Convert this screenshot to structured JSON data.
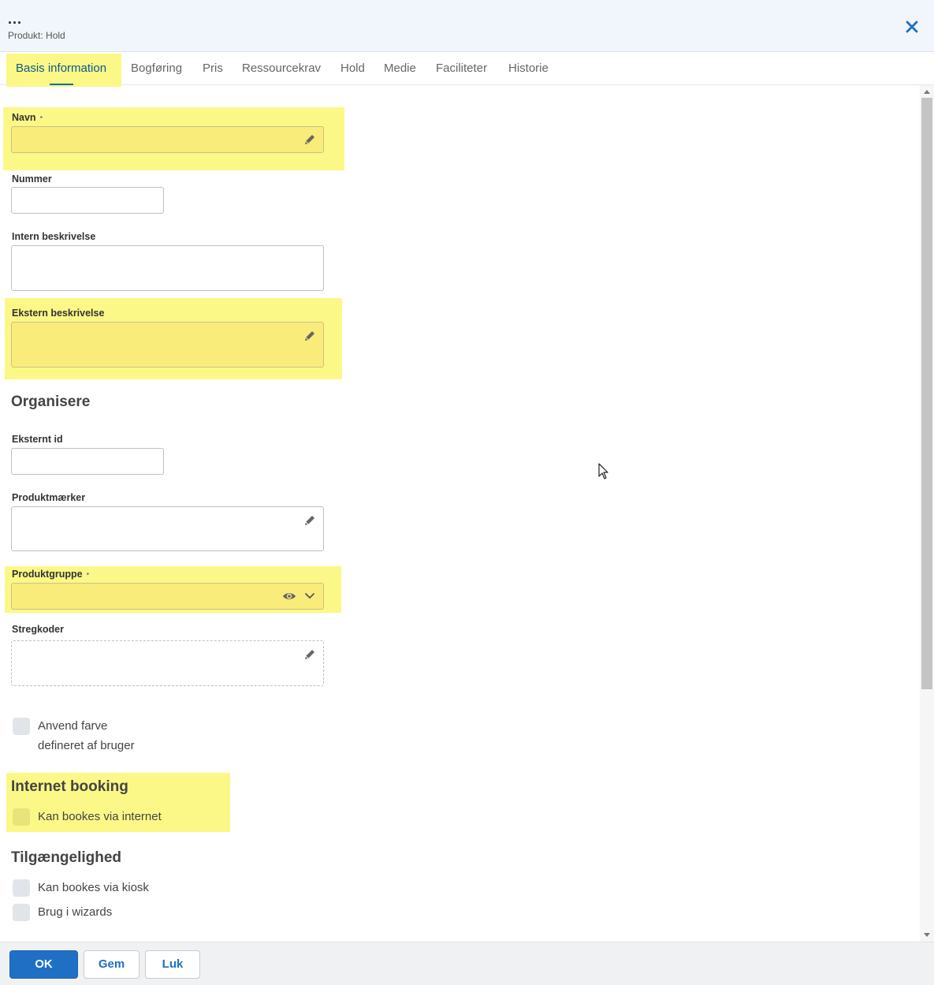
{
  "header": {
    "menu_label": "...",
    "subtitle": "Produkt: Hold"
  },
  "tabs": [
    {
      "label": "Basis information",
      "active": true
    },
    {
      "label": "Bogføring"
    },
    {
      "label": "Pris"
    },
    {
      "label": "Ressourcekrav"
    },
    {
      "label": "Hold"
    },
    {
      "label": "Medie"
    },
    {
      "label": "Faciliteter"
    },
    {
      "label": "Historie"
    }
  ],
  "form": {
    "navn": {
      "label": "Navn",
      "value": "",
      "required_marker": "•"
    },
    "nummer": {
      "label": "Nummer",
      "value": ""
    },
    "intern_beskrivelse": {
      "label": "Intern beskrivelse",
      "value": ""
    },
    "ekstern_beskrivelse": {
      "label": "Ekstern beskrivelse",
      "value": ""
    },
    "organisere_title": "Organisere",
    "eksternt_id": {
      "label": "Eksternt id",
      "value": ""
    },
    "produktmaerker": {
      "label": "Produktmærker",
      "value": ""
    },
    "produktgruppe": {
      "label": "Produktgruppe",
      "value": "",
      "required_marker": "•"
    },
    "stregkoder": {
      "label": "Stregkoder",
      "value": ""
    },
    "anvend_farve": {
      "line1": "Anvend farve",
      "line2": "defineret af bruger",
      "checked": false
    },
    "internet_title": "Internet booking",
    "kan_bookes_internet": {
      "label": "Kan bookes via internet",
      "checked": false
    },
    "tilgaengelighed_title": "Tilgængelighed",
    "kan_bookes_kiosk": {
      "label": "Kan bookes via kiosk",
      "checked": false
    },
    "brug_i_wizards": {
      "label": "Brug i wizards",
      "checked": false
    }
  },
  "footer": {
    "ok_label": "OK",
    "gem_label": "Gem",
    "luk_label": "Luk"
  },
  "colors": {
    "highlight": "#fbf887",
    "primary": "#1f6fc5",
    "active_tab": "#0a5a8c"
  },
  "icons": [
    "close-icon",
    "pencil-icon",
    "eye-icon",
    "chevron-down-icon",
    "mouse-cursor"
  ]
}
